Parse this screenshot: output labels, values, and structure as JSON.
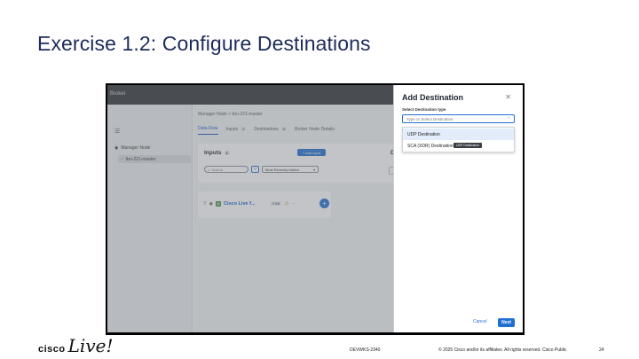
{
  "slide": {
    "title": "Exercise 1.2: Configure Destinations",
    "footer_code": "DEVWKS-2340",
    "footer_copy": "© 2025 Cisco and/or its affiliates. All rights reserved.   Cisco Public",
    "page_number": "24",
    "logo_text_1": "cisco",
    "logo_text_2": "Live!"
  },
  "app": {
    "topbar_title": "Broker",
    "sidebar": {
      "root": "Manager Node",
      "child": "tbn-221-master"
    },
    "breadcrumb": "Manager Node  >  tbn-221-master",
    "tabs": [
      {
        "label": "Data Flow",
        "count": ""
      },
      {
        "label": "Inputs",
        "count": "1"
      },
      {
        "label": "Destinations",
        "count": "0"
      },
      {
        "label": "Broker Node Details",
        "count": ""
      }
    ],
    "inputs": {
      "title": "Inputs",
      "count": "1",
      "add_button": "+ Add input",
      "search_placeholder": "Search",
      "sort_value": "Most Recently Added"
    },
    "destinations_col_initial": "D",
    "input_row": {
      "name": "Cisco Live f...",
      "size": "0 KB"
    }
  },
  "panel": {
    "title": "Add Destination",
    "field_label": "Select Destination type",
    "placeholder": "Type or Select Destination",
    "options": [
      "UDP Destination",
      "SCA (XDR) Destination"
    ],
    "tooltip": "UDP Destination",
    "cancel": "Cancel",
    "next": "Next"
  },
  "colors": {
    "accent": "#1f6fd1",
    "title": "#1d2b5a"
  }
}
